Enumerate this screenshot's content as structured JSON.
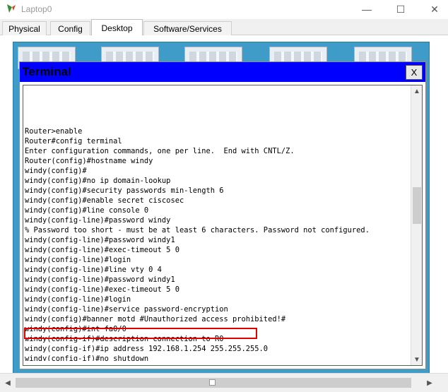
{
  "window": {
    "title": "Laptop0",
    "minimize_glyph": "—",
    "maximize_glyph": "☐",
    "close_glyph": "✕"
  },
  "tabs": [
    {
      "label": "Physical"
    },
    {
      "label": "Config"
    },
    {
      "label": "Desktop"
    },
    {
      "label": "Software/Services"
    }
  ],
  "active_tab": "Desktop",
  "terminal": {
    "title": "Terminal",
    "close_label": "X",
    "lines": [
      "",
      "",
      "",
      "",
      "Router>enable",
      "Router#config terminal",
      "Enter configuration commands, one per line.  End with CNTL/Z.",
      "Router(config)#hostname windy",
      "windy(config)#",
      "windy(config)#no ip domain-lookup",
      "windy(config)#security passwords min-length 6",
      "windy(config)#enable secret ciscosec",
      "windy(config)#line console 0",
      "windy(config-line)#password windy",
      "% Password too short - must be at least 6 characters. Password not configured.",
      "windy(config-line)#password windy1",
      "windy(config-line)#exec-timeout 5 0",
      "windy(config-line)#login",
      "windy(config-line)#line vty 0 4",
      "windy(config-line)#password windy1",
      "windy(config-line)#exec-timeout 5 0",
      "windy(config-line)#login",
      "windy(config-line)#service password-encryption",
      "windy(config)#banner motd #Unauthorized access prohibited!#",
      "windy(config)#int fa0/0",
      "windy(config-if)#description connection to R0",
      "windy(config-if)#ip address 192.168.1.254 255.255.255.0",
      "windy(config-if)#no shutdown"
    ],
    "highlighted_line": "windy(config-if)#description connection to R0"
  },
  "icons": {
    "app": "packet-tracer-laptop-icon",
    "scroll_up": "▲",
    "scroll_down": "▼",
    "scroll_left": "◀",
    "scroll_right": "▶"
  },
  "colors": {
    "terminal_titlebar": "#0000ff",
    "desktop_background": "#3f9cc9",
    "highlight_border": "#e00000"
  }
}
